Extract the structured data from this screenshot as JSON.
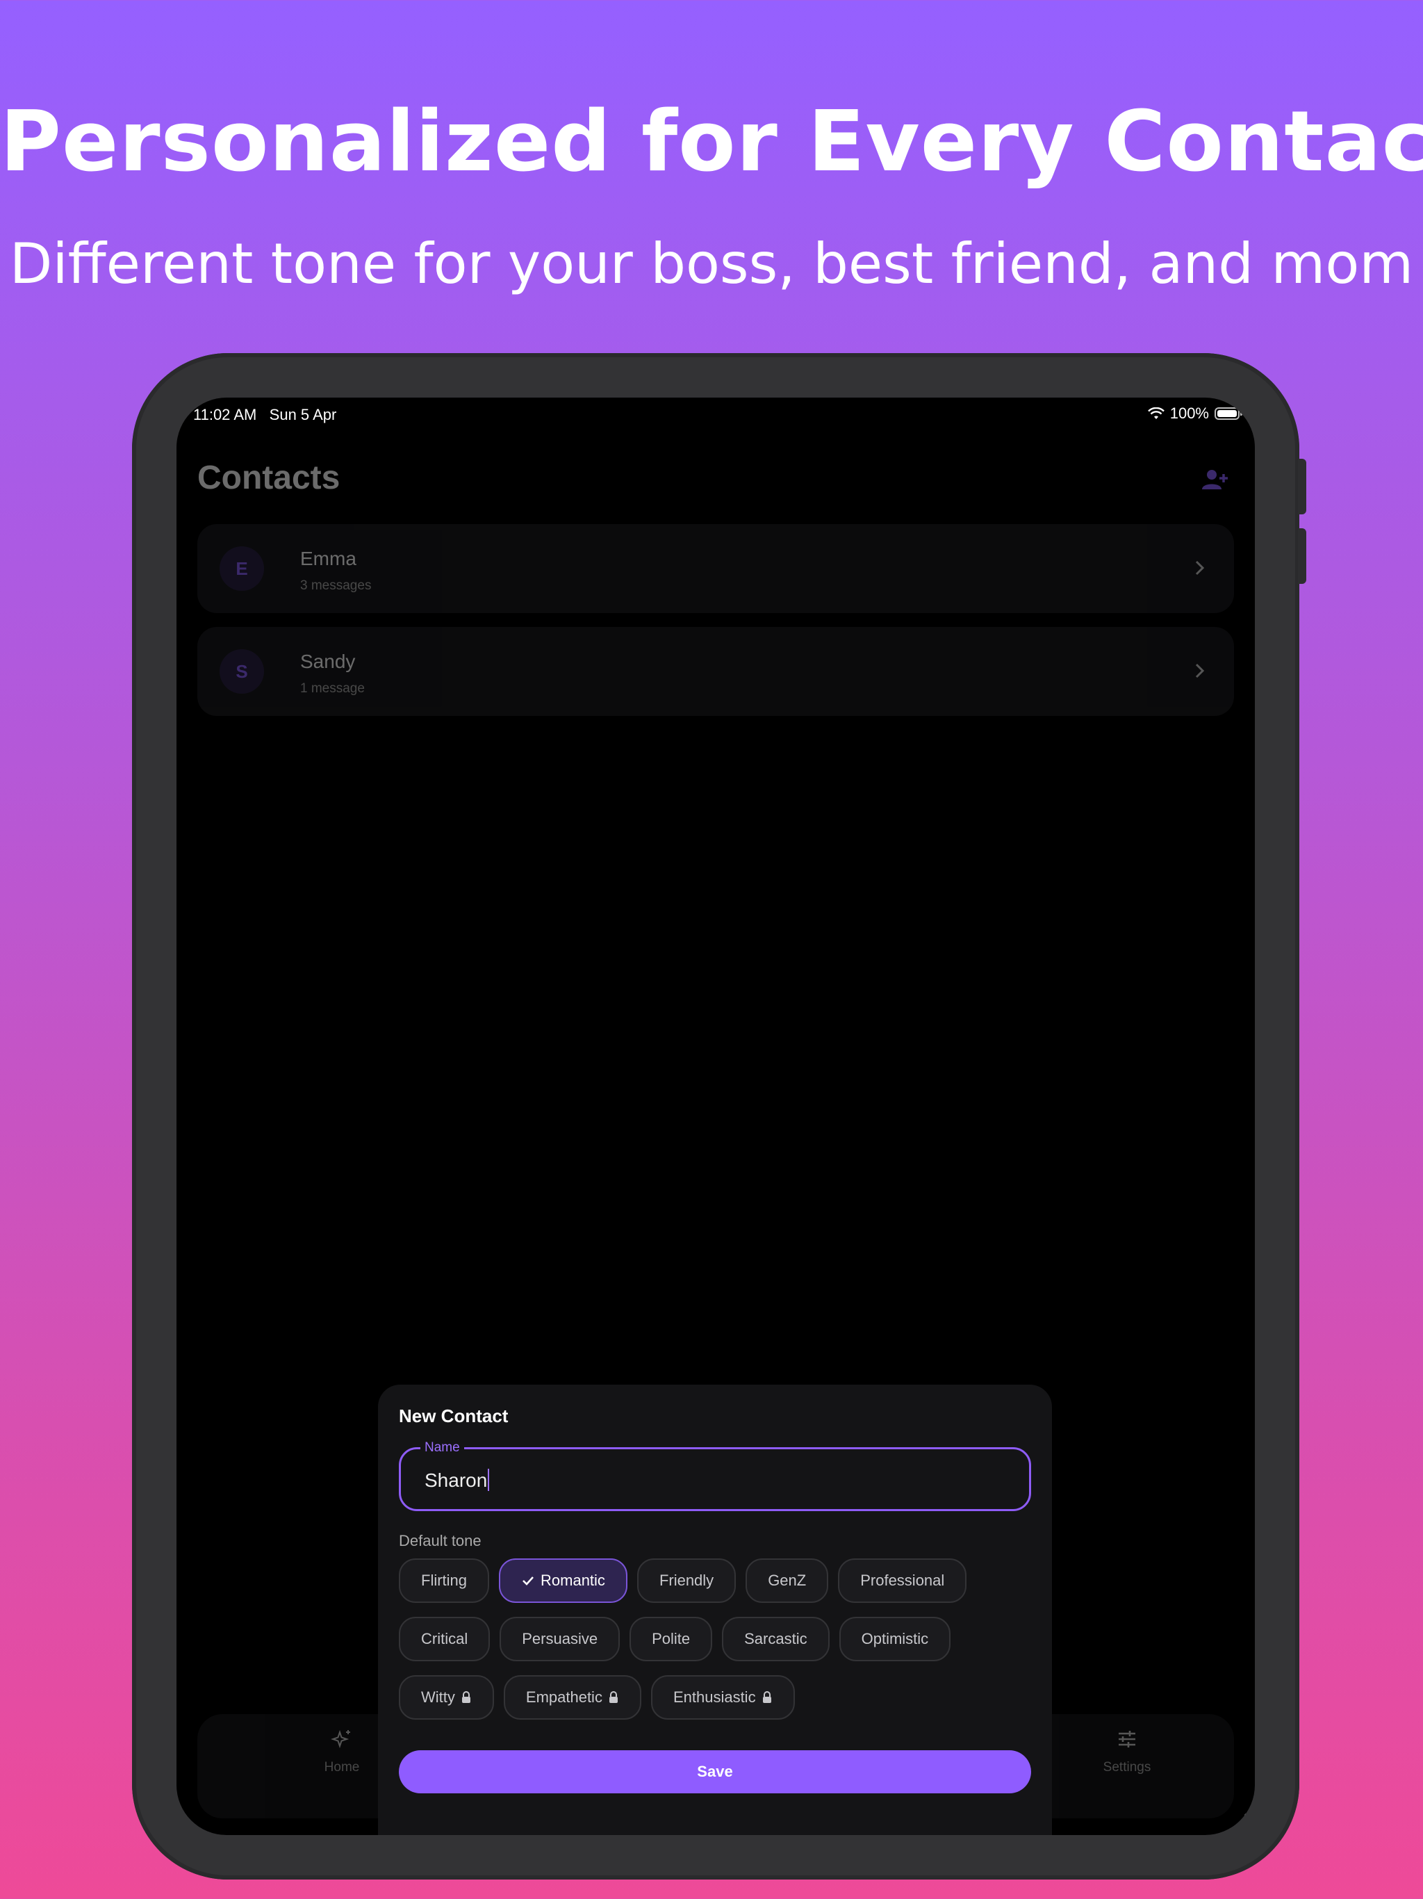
{
  "promo": {
    "title": "Personalized for Every Contact",
    "subtitle": "Different tone for your boss, best friend, and mom"
  },
  "status_bar": {
    "time": "11:02 AM",
    "date": "Sun 5 Apr",
    "battery": "100%"
  },
  "contacts_page": {
    "title": "Contacts",
    "add_icon": "person-add-icon",
    "contacts": [
      {
        "initial": "E",
        "name": "Emma",
        "subtitle": "3 messages"
      },
      {
        "initial": "S",
        "name": "Sandy",
        "subtitle": "1 message"
      }
    ]
  },
  "bottom_nav": {
    "home_label": "Home",
    "settings_label": "Settings"
  },
  "new_contact_sheet": {
    "title": "New Contact",
    "name_label": "Name",
    "name_value": "Sharon",
    "tone_label": "Default tone",
    "tones_row1": [
      "Flirting",
      "Romantic",
      "Friendly",
      "GenZ",
      "Professional"
    ],
    "tones_row2": [
      "Critical",
      "Persuasive",
      "Polite",
      "Sarcastic",
      "Optimistic"
    ],
    "tones_row3_locked": [
      "Witty",
      "Empathetic",
      "Enthusiastic"
    ],
    "selected_tone": "Romantic",
    "save_label": "Save"
  },
  "colors": {
    "accent": "#8f5cff",
    "background_top": "#9560ff",
    "background_bottom": "#ee4a98"
  }
}
